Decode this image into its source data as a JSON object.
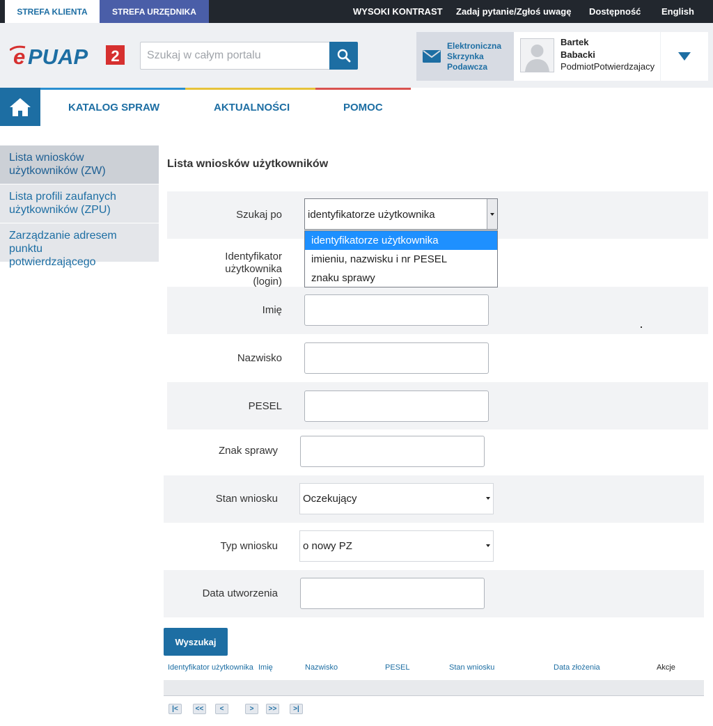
{
  "topbar": {
    "zone_client": "STREFA KLIENTA",
    "zone_official": "STREFA URZĘDNIKA",
    "links": {
      "high_contrast": "WYSOKI KONTRAST",
      "ask": "Zadaj pytanie/Zgłoś uwagę",
      "accessibility": "Dostępność",
      "language": "English"
    }
  },
  "header": {
    "logo_label": "ePUAP2",
    "search_placeholder": "Szukaj w całym portalu",
    "mailbox": {
      "line1": "Elektroniczna",
      "line2": "Skrzynka",
      "line3": "Podawcza"
    },
    "user": {
      "first_name": "Bartek",
      "last_name": "Babacki",
      "role": "PodmiotPotwierdzajacy"
    }
  },
  "nav": {
    "items": [
      "KATALOG SPRAW",
      "AKTUALNOŚCI",
      "POMOC"
    ]
  },
  "sidebar": {
    "items": [
      {
        "line1": "Lista wniosków",
        "line2": "użytkowników (ZW)",
        "active": true
      },
      {
        "line1": "Lista profili zaufanych",
        "line2": "użytkowników (ZPU)",
        "active": false
      },
      {
        "line1": "Zarządzanie adresem punktu",
        "line2": "potwierdzającego",
        "active": false
      }
    ]
  },
  "main": {
    "title": "Lista wniosków użytkowników",
    "form": {
      "search_by_label": "Szukaj po",
      "search_by_value": "identyfikatorze użytkownika",
      "search_by_options": [
        "identyfikatorze użytkownika",
        "imieniu, nazwisku i nr PESEL",
        "znaku sprawy"
      ],
      "login_label_line1": "Identyfikator użytkownika",
      "login_label_line2": "(login)",
      "first_name_label": "Imię",
      "last_name_label": "Nazwisko",
      "pesel_label": "PESEL",
      "case_number_label": "Znak sprawy",
      "status_label": "Stan wniosku",
      "status_value": "Oczekujący",
      "type_label": "Typ wniosku",
      "type_value": "o nowy PZ",
      "created_label": "Data utworzenia",
      "submit_label": "Wyszukaj"
    },
    "table": {
      "headers": [
        "Identyfikator użytkownika",
        "Imię",
        "Nazwisko",
        "PESEL",
        "Stan wniosku",
        "Data złożenia",
        "Akcje"
      ]
    },
    "pager": [
      "|<",
      "<<",
      "<",
      ">",
      ">>",
      ">|"
    ]
  },
  "colors": {
    "brand_blue": "#1d6ea3",
    "official_tab": "#4a5ea8",
    "bar_blue": "#2a8fd0",
    "bar_yellow": "#e6c33a",
    "bar_red": "#d9534f",
    "logo_red": "#d6302f"
  }
}
